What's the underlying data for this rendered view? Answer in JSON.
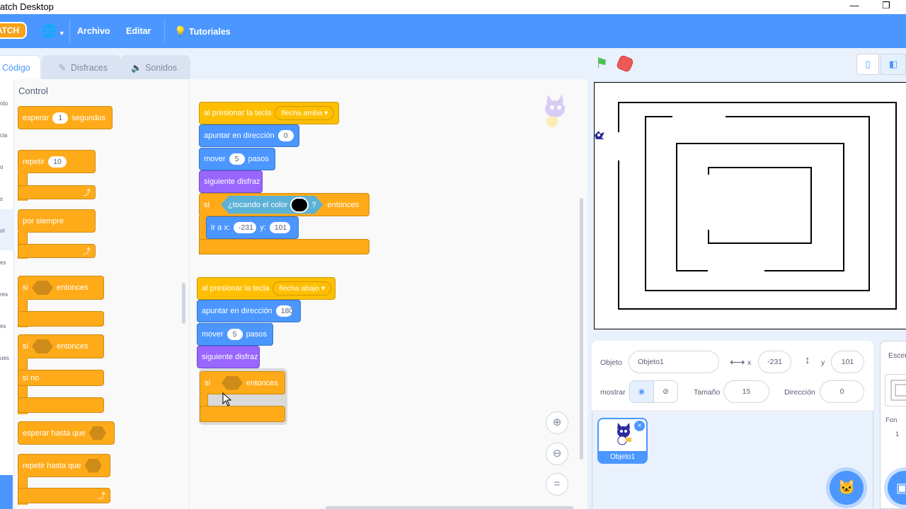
{
  "window": {
    "title": "atch Desktop",
    "minimize": "—",
    "restore": "❐"
  },
  "menubar": {
    "logo": "ATCH",
    "language_icon": "🌐",
    "file": "Archivo",
    "edit": "Editar",
    "tutorials": "Tutoriales"
  },
  "tabs": {
    "code": "Código",
    "costumes": "Disfraces",
    "sounds": "Sonidos"
  },
  "categories": [
    "nto",
    "cia",
    "o",
    "s",
    "ol",
    "es",
    "res",
    "es",
    "ues"
  ],
  "palette": {
    "title": "Control",
    "wait": {
      "label": "esperar",
      "value": "1",
      "suffix": "segundos"
    },
    "repeat": {
      "label": "repetir",
      "value": "10"
    },
    "forever": "por siempre",
    "if_then": {
      "if": "si",
      "then": "entonces"
    },
    "if_else": {
      "if": "si",
      "then": "entonces",
      "else": "si no"
    },
    "wait_until": "esperar hasta que",
    "repeat_until": "repetir hasta que"
  },
  "script1": {
    "hat": "al presionar la tecla",
    "key": "flecha arriba",
    "point": "apuntar en dirección",
    "point_value": "0",
    "move": "mover",
    "move_value": "5",
    "steps": "pasos",
    "next_costume": "siguiente disfraz",
    "if": "si",
    "touching": "¿tocando el color",
    "question": "?",
    "then": "entonces",
    "goto": "ir a x:",
    "goto_x": "-231",
    "goto_y_label": "y:",
    "goto_y": "101"
  },
  "script2": {
    "hat": "al presionar la tecla",
    "key": "flecha abajo",
    "point": "apuntar en dirección",
    "point_value": "180",
    "move": "mover",
    "move_value": "5",
    "steps": "pasos",
    "next_costume": "siguiente disfraz",
    "if": "si",
    "then": "entonces"
  },
  "zoom": {
    "in": "+",
    "out": "−",
    "reset": "="
  },
  "sprite_info": {
    "sprite_label": "Objeto",
    "sprite_name": "Objeto1",
    "x_label": "x",
    "x_value": "-231",
    "y_label": "y",
    "y_value": "101",
    "show_label": "mostrar",
    "size_label": "Tamaño",
    "size_value": "15",
    "direction_label": "Dirección",
    "direction_value": "0"
  },
  "sprite_list": {
    "sprite_name": "Objeto1",
    "delete": "×"
  },
  "stage_panel": {
    "title": "Escen",
    "backdrops_label": "Fon",
    "backdrops_count": "1"
  },
  "colors": {
    "menubar": "#4c97ff",
    "events": "#ffbf00",
    "motion": "#4c97ff",
    "looks": "#9966ff",
    "control": "#ffab19",
    "sensing": "#5cb1d6",
    "touching_color": "#000000"
  }
}
